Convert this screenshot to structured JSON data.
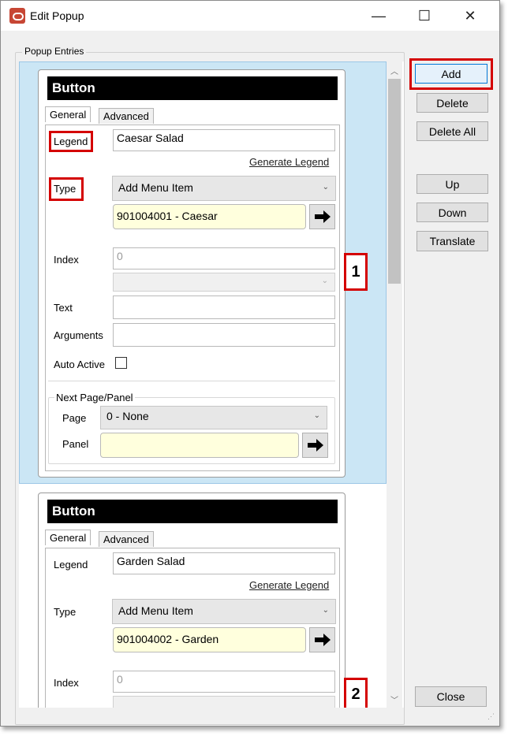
{
  "window": {
    "title": "Edit Popup",
    "controls": {
      "minimize": "—",
      "maximize": "☐",
      "close": "✕"
    }
  },
  "group": {
    "label": "Popup Entries"
  },
  "entries": [
    {
      "header": "Button",
      "tabs": [
        "General",
        "Advanced"
      ],
      "legend_label": "Legend",
      "legend_value": "Caesar Salad",
      "generate_legend": "Generate Legend",
      "type_label": "Type",
      "type_value": "Add Menu Item",
      "menu_item": "901004001 - Caesar",
      "index_label": "Index",
      "index_value": "0",
      "text_label": "Text",
      "arguments_label": "Arguments",
      "auto_active_label": "Auto Active",
      "next_page_panel": "Next Page/Panel",
      "page_label": "Page",
      "page_value": "0 - None",
      "panel_label": "Panel",
      "callout": "1"
    },
    {
      "header": "Button",
      "tabs": [
        "General",
        "Advanced"
      ],
      "legend_label": "Legend",
      "legend_value": "Garden Salad",
      "generate_legend": "Generate Legend",
      "type_label": "Type",
      "type_value": "Add Menu Item",
      "menu_item": "901004002 - Garden",
      "index_label": "Index",
      "index_value": "0",
      "callout": "2"
    }
  ],
  "buttons": {
    "add": "Add",
    "delete": "Delete",
    "delete_all": "Delete All",
    "up": "Up",
    "down": "Down",
    "translate": "Translate",
    "close": "Close"
  },
  "colors": {
    "highlight_red": "#d40000",
    "selection_blue": "#cbe6f5",
    "input_yellow": "#ffffdd",
    "app_icon": "#c74634"
  }
}
